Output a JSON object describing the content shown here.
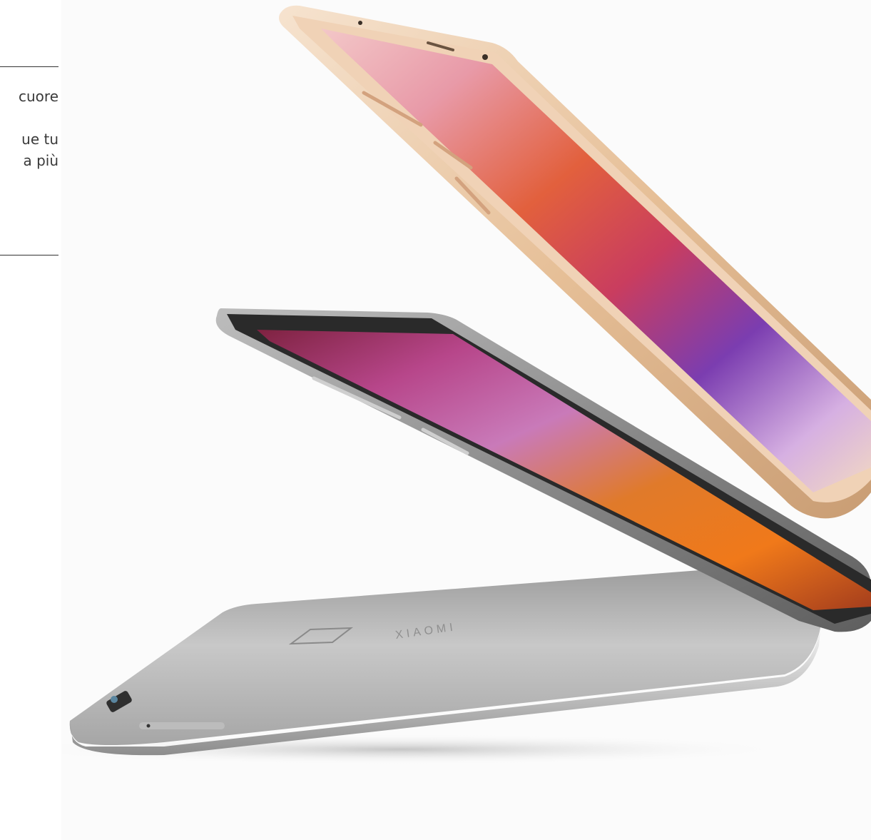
{
  "text_panel": {
    "line1": "cuore",
    "line2": "ue tu",
    "line3": "a più"
  },
  "colors": {
    "background": "#ffffff",
    "text": "#3a3a3a",
    "rule": "#333333",
    "gold_frame": "#e8c7a4",
    "grey_frame": "#8e8e8e",
    "back_silver": "#c9c9c9"
  },
  "brand_mark": "XIAOMI"
}
